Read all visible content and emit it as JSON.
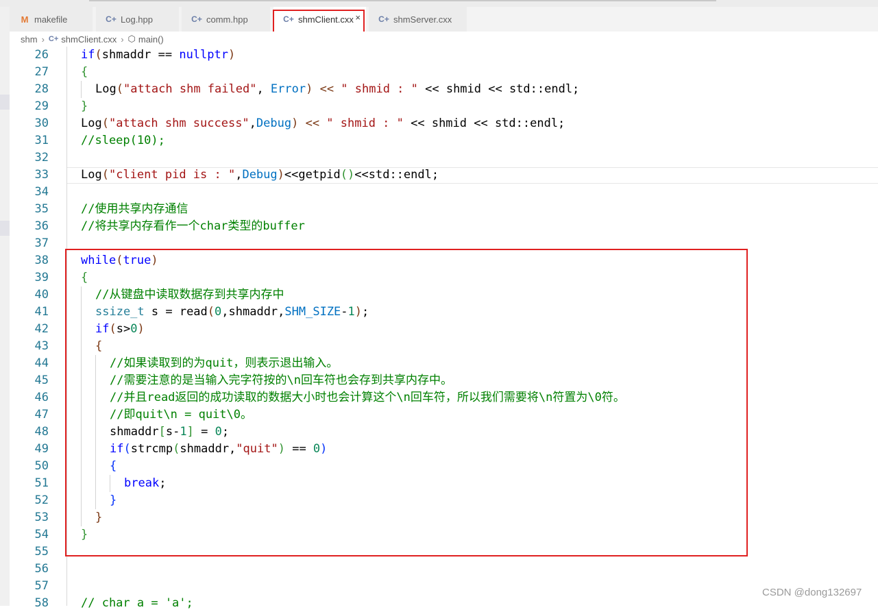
{
  "tabs": [
    {
      "label": "makefile",
      "icon": "makefile-icon",
      "glyph": "M"
    },
    {
      "label": "Log.hpp",
      "icon": "cpp-file-icon",
      "glyph": "C+"
    },
    {
      "label": "comm.hpp",
      "icon": "cpp-file-icon",
      "glyph": "C+"
    },
    {
      "label": "shmClient.cxx",
      "icon": "cpp-file-icon",
      "glyph": "C+",
      "active": true
    },
    {
      "label": "shmServer.cxx",
      "icon": "cpp-file-icon",
      "glyph": "C+"
    }
  ],
  "close_glyph": "×",
  "breadcrumb": {
    "folder": "shm",
    "file": "shmClient.cxx",
    "symbol": "main()"
  },
  "line_numbers": [
    "26",
    "27",
    "28",
    "29",
    "30",
    "31",
    "32",
    "33",
    "34",
    "35",
    "36",
    "37",
    "38",
    "39",
    "40",
    "41",
    "42",
    "43",
    "44",
    "45",
    "46",
    "47",
    "48",
    "49",
    "50",
    "51",
    "52",
    "53",
    "54",
    "55",
    "56",
    "57",
    "58"
  ],
  "code": {
    "l26": {
      "a": "if",
      "b": "(",
      "c": "shmaddr == ",
      "d": "nullptr",
      "e": ")"
    },
    "l27": {
      "a": "{"
    },
    "l28": {
      "a": "Log",
      "b": "(",
      "c": "\"attach shm failed\"",
      "d": ", ",
      "e": "Error",
      "f": ") << ",
      "g": "\" shmid : \"",
      "h": " << shmid << std::endl;"
    },
    "l29": {
      "a": "}"
    },
    "l30": {
      "a": "Log",
      "b": "(",
      "c": "\"attach shm success\"",
      "d": ",",
      "e": "Debug",
      "f": ") << ",
      "g": "\" shmid : \"",
      "h": " << shmid << std::endl;"
    },
    "l31": {
      "a": "//sleep(10);"
    },
    "l33": {
      "a": "Log",
      "b": "(",
      "c": "\"client pid is : \"",
      "d": ",",
      "e": "Debug",
      "f": ")",
      "g": "<<getpid",
      "h": "()",
      "i": "<<std::endl;"
    },
    "l35": {
      "a": "//使用共享内存通信"
    },
    "l36": {
      "a": "//将共享内存看作一个char类型的buffer"
    },
    "l38": {
      "a": "while",
      "b": "(",
      "c": "true",
      "d": ")"
    },
    "l39": {
      "a": "{"
    },
    "l40": {
      "a": "//从键盘中读取数据存到共享内存中"
    },
    "l41": {
      "a": "ssize_t",
      "b": " s = read",
      "c": "(",
      "d": "0",
      "e": ",shmaddr,",
      "f": "SHM_SIZE",
      "g": "-",
      "h": "1",
      "i": ")",
      "j": ";"
    },
    "l42": {
      "a": "if",
      "b": "(",
      "c": "s>",
      "d": "0",
      "e": ")"
    },
    "l43": {
      "a": "{"
    },
    "l44": {
      "a": "//如果读取到的为quit，则表示退出输入。"
    },
    "l45": {
      "a": "//需要注意的是当输入完字符按的\\n回车符也会存到共享内存中。"
    },
    "l46": {
      "a": "//并且read返回的成功读取的数据大小时也会计算这个\\n回车符，所以我们需要将\\n符置为\\0符。"
    },
    "l47": {
      "a": "//即quit\\n = quit\\0。"
    },
    "l48": {
      "a": "shmaddr",
      "b": "[",
      "c": "s-",
      "d": "1",
      "e": "]",
      "f": " = ",
      "g": "0",
      "h": ";"
    },
    "l49": {
      "a": "if",
      "b": "(",
      "c": "strcmp",
      "d": "(",
      "e": "shmaddr,",
      "f": "\"quit\"",
      "g": ")",
      "h": " == ",
      "i": "0",
      "j": ")"
    },
    "l50": {
      "a": "{"
    },
    "l51": {
      "a": "break",
      "b": ";"
    },
    "l52": {
      "a": "}"
    },
    "l53": {
      "a": "}"
    },
    "l54": {
      "a": "}"
    },
    "l58": {
      "a": "// char a = 'a';"
    }
  },
  "watermark": "CSDN @dong132697"
}
